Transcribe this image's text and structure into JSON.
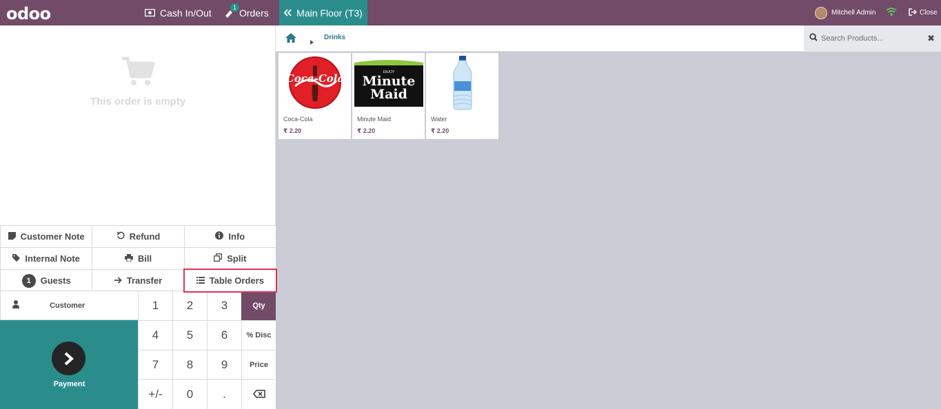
{
  "topbar": {
    "logo": "odoo",
    "cash_label": "Cash In/Out",
    "orders_label": "Orders",
    "orders_badge": "1",
    "floor_label": "Main Floor (T3)",
    "user_name": "Mitchell Admin",
    "close_label": "Close"
  },
  "order": {
    "empty_text": "This order is empty"
  },
  "controls": {
    "customer_note": "Customer Note",
    "refund": "Refund",
    "info": "Info",
    "internal_note": "Internal Note",
    "bill": "Bill",
    "split": "Split",
    "guests_count": "1",
    "guests": "Guests",
    "transfer": "Transfer",
    "table_orders": "Table Orders"
  },
  "actionpad": {
    "customer": "Customer",
    "payment": "Payment"
  },
  "numpad": {
    "keys": [
      "1",
      "2",
      "3",
      "Qty",
      "4",
      "5",
      "6",
      "% Disc",
      "7",
      "8",
      "9",
      "Price",
      "+/-",
      "0",
      ".",
      "⌫"
    ],
    "active_mode": "Qty"
  },
  "breadcrumb": {
    "category": "Drinks"
  },
  "search": {
    "placeholder": "Search Products..."
  },
  "products": [
    {
      "name": "Coca-Cola",
      "price": "₹ 2.20",
      "image_icon": "coca-cola-logo"
    },
    {
      "name": "Minute Maid",
      "price": "₹ 2.20",
      "image_icon": "minute-maid-logo",
      "logo_line1": "Minute",
      "logo_line2": "Maid",
      "logo_top": "ENJOY"
    },
    {
      "name": "Water",
      "price": "₹ 2.20",
      "image_icon": "water-bottle"
    }
  ],
  "colors": {
    "brand": "#714b67",
    "accent": "#2a8d8c",
    "highlight": "#e0344f"
  }
}
